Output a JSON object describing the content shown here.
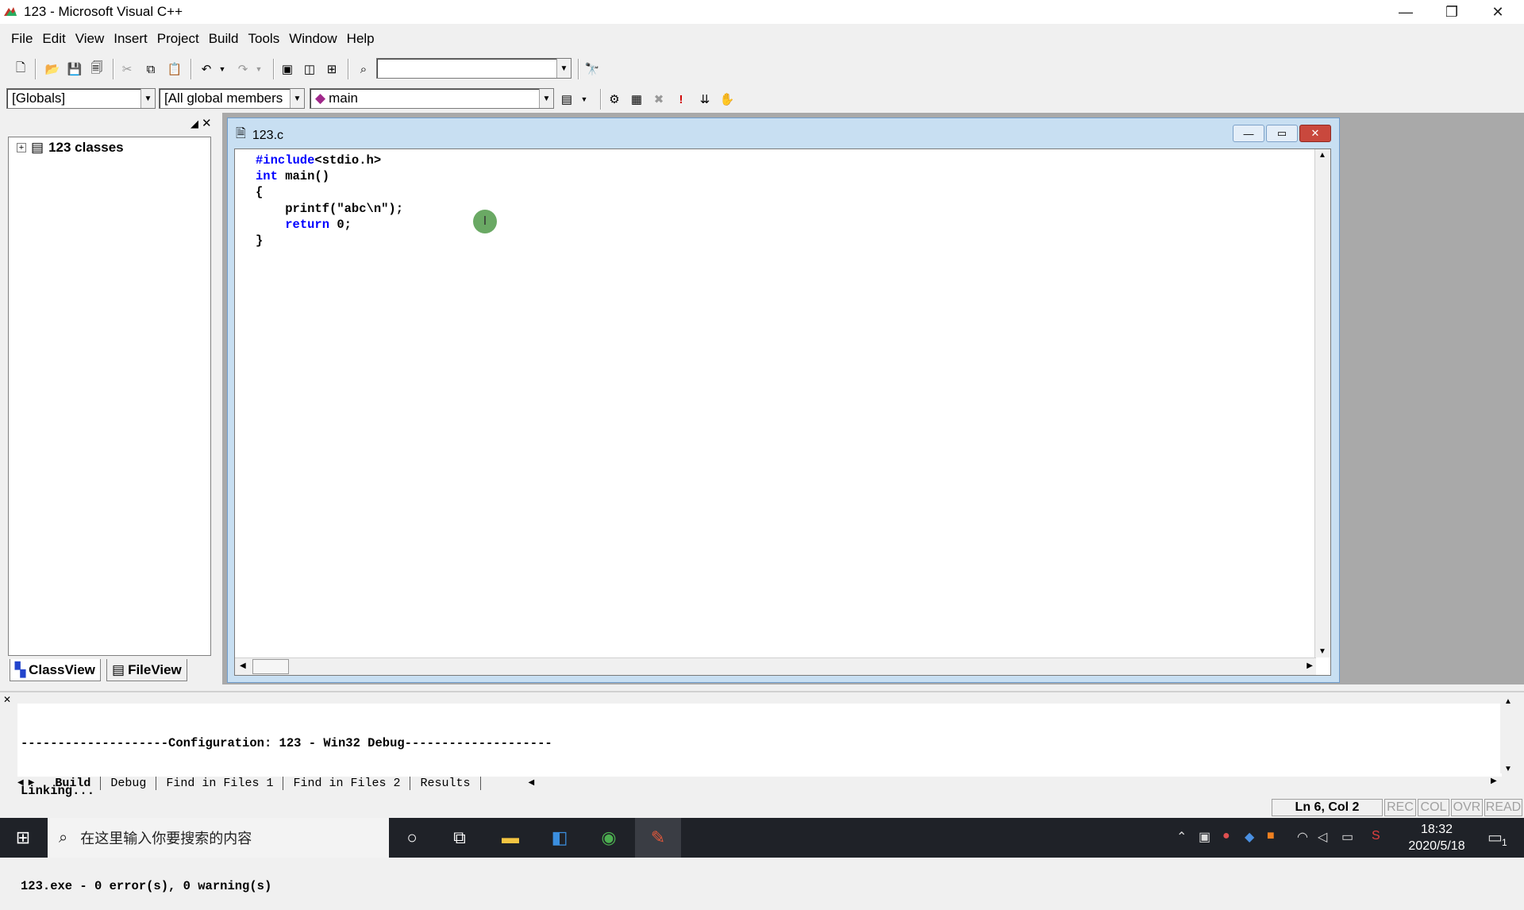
{
  "window": {
    "title": "123 - Microsoft Visual C++",
    "minimize": "—",
    "restore": "❐",
    "close": "✕"
  },
  "menu": [
    "File",
    "Edit",
    "View",
    "Insert",
    "Project",
    "Build",
    "Tools",
    "Window",
    "Help"
  ],
  "wizardbar": {
    "scope": "[Globals]",
    "filter": "[All global members",
    "function": "main"
  },
  "workspace": {
    "tree_item": "123 classes",
    "tabs": [
      "ClassView",
      "FileView"
    ]
  },
  "document": {
    "title": "123.c",
    "code": [
      "#include<stdio.h>",
      "int main()",
      "{",
      "    printf(\"abc\\n\");",
      "    return 0;",
      "}"
    ]
  },
  "output": {
    "lines": [
      "--------------------Configuration: 123 - Win32 Debug--------------------",
      "Linking...",
      "",
      "123.exe - 0 error(s), 0 warning(s)"
    ],
    "tabs": [
      "Build",
      "Debug",
      "Find in Files 1",
      "Find in Files 2",
      "Results"
    ]
  },
  "statusbar": {
    "position": "Ln 6, Col 2",
    "rec": "REC",
    "col": "COL",
    "ovr": "OVR",
    "read": "READ"
  },
  "taskbar": {
    "search_placeholder": "在这里输入你要搜索的内容",
    "time": "18:32",
    "date": "2020/5/18",
    "notification_count": "1"
  },
  "colors": {
    "keyword": "#0000ff",
    "doc_frame": "#c8dff2",
    "taskbar": "#1f2228"
  }
}
